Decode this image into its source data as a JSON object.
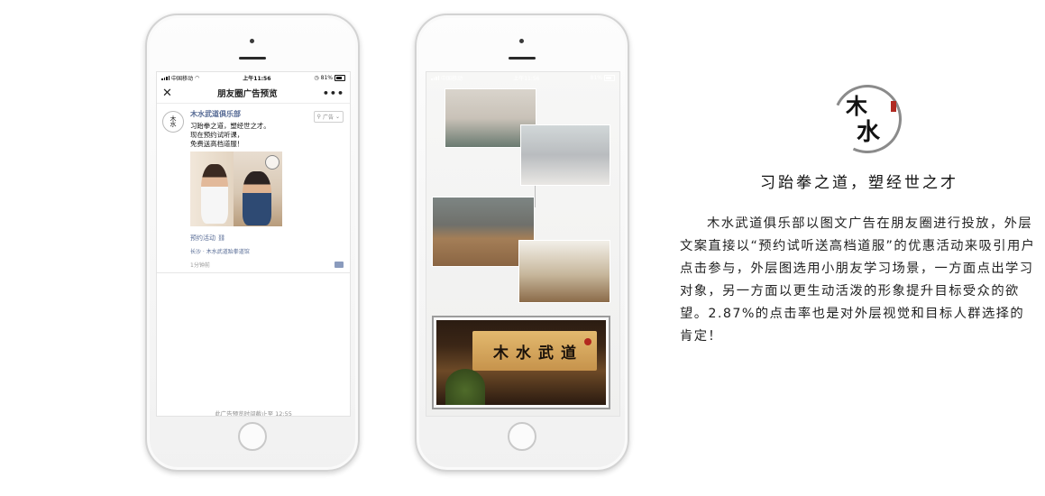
{
  "status_bar": {
    "carrier": "中国移动",
    "time": "上午11:56",
    "battery": "81%"
  },
  "nav": {
    "title": "朋友圈广告预览",
    "close_glyph": "✕",
    "more_glyph": "•••"
  },
  "post": {
    "author": "木水武道俱乐部",
    "ad_tag": "广告",
    "copy_lines": [
      "习跆拳之道，塑经世之才。",
      "现在预约试听课，",
      "免费送高档道服！"
    ],
    "link_text": "预约活动",
    "location": "长沙 · 木水武道跆拳道馆",
    "time_ago": "1分钟前"
  },
  "preview_deadline": "此广告预览时间截止至 12:55",
  "plaque_text": [
    "木",
    "水",
    "武",
    "道"
  ],
  "logo_chars": [
    "木",
    "水"
  ],
  "slogan": "习跆拳之道，塑经世之才",
  "description": "木水武道俱乐部以图文广告在朋友圈进行投放，外层文案直接以“预约试听送高档道服”的优惠活动来吸引用户点击参与，外层图选用小朋友学习场景，一方面点出学习对象，另一方面以更生动活泼的形象提升目标受众的欲望。2.87%的点击率也是对外层视觉和目标人群选择的肯定！",
  "colors": {
    "wechat_link": "#576b95",
    "seal_red": "#b02a22"
  },
  "icons": [
    "signal-icon",
    "wifi-icon",
    "battery-icon",
    "close-icon",
    "more-icon",
    "location-pin-icon",
    "chevron-down-icon",
    "link-icon",
    "comment-icon"
  ]
}
